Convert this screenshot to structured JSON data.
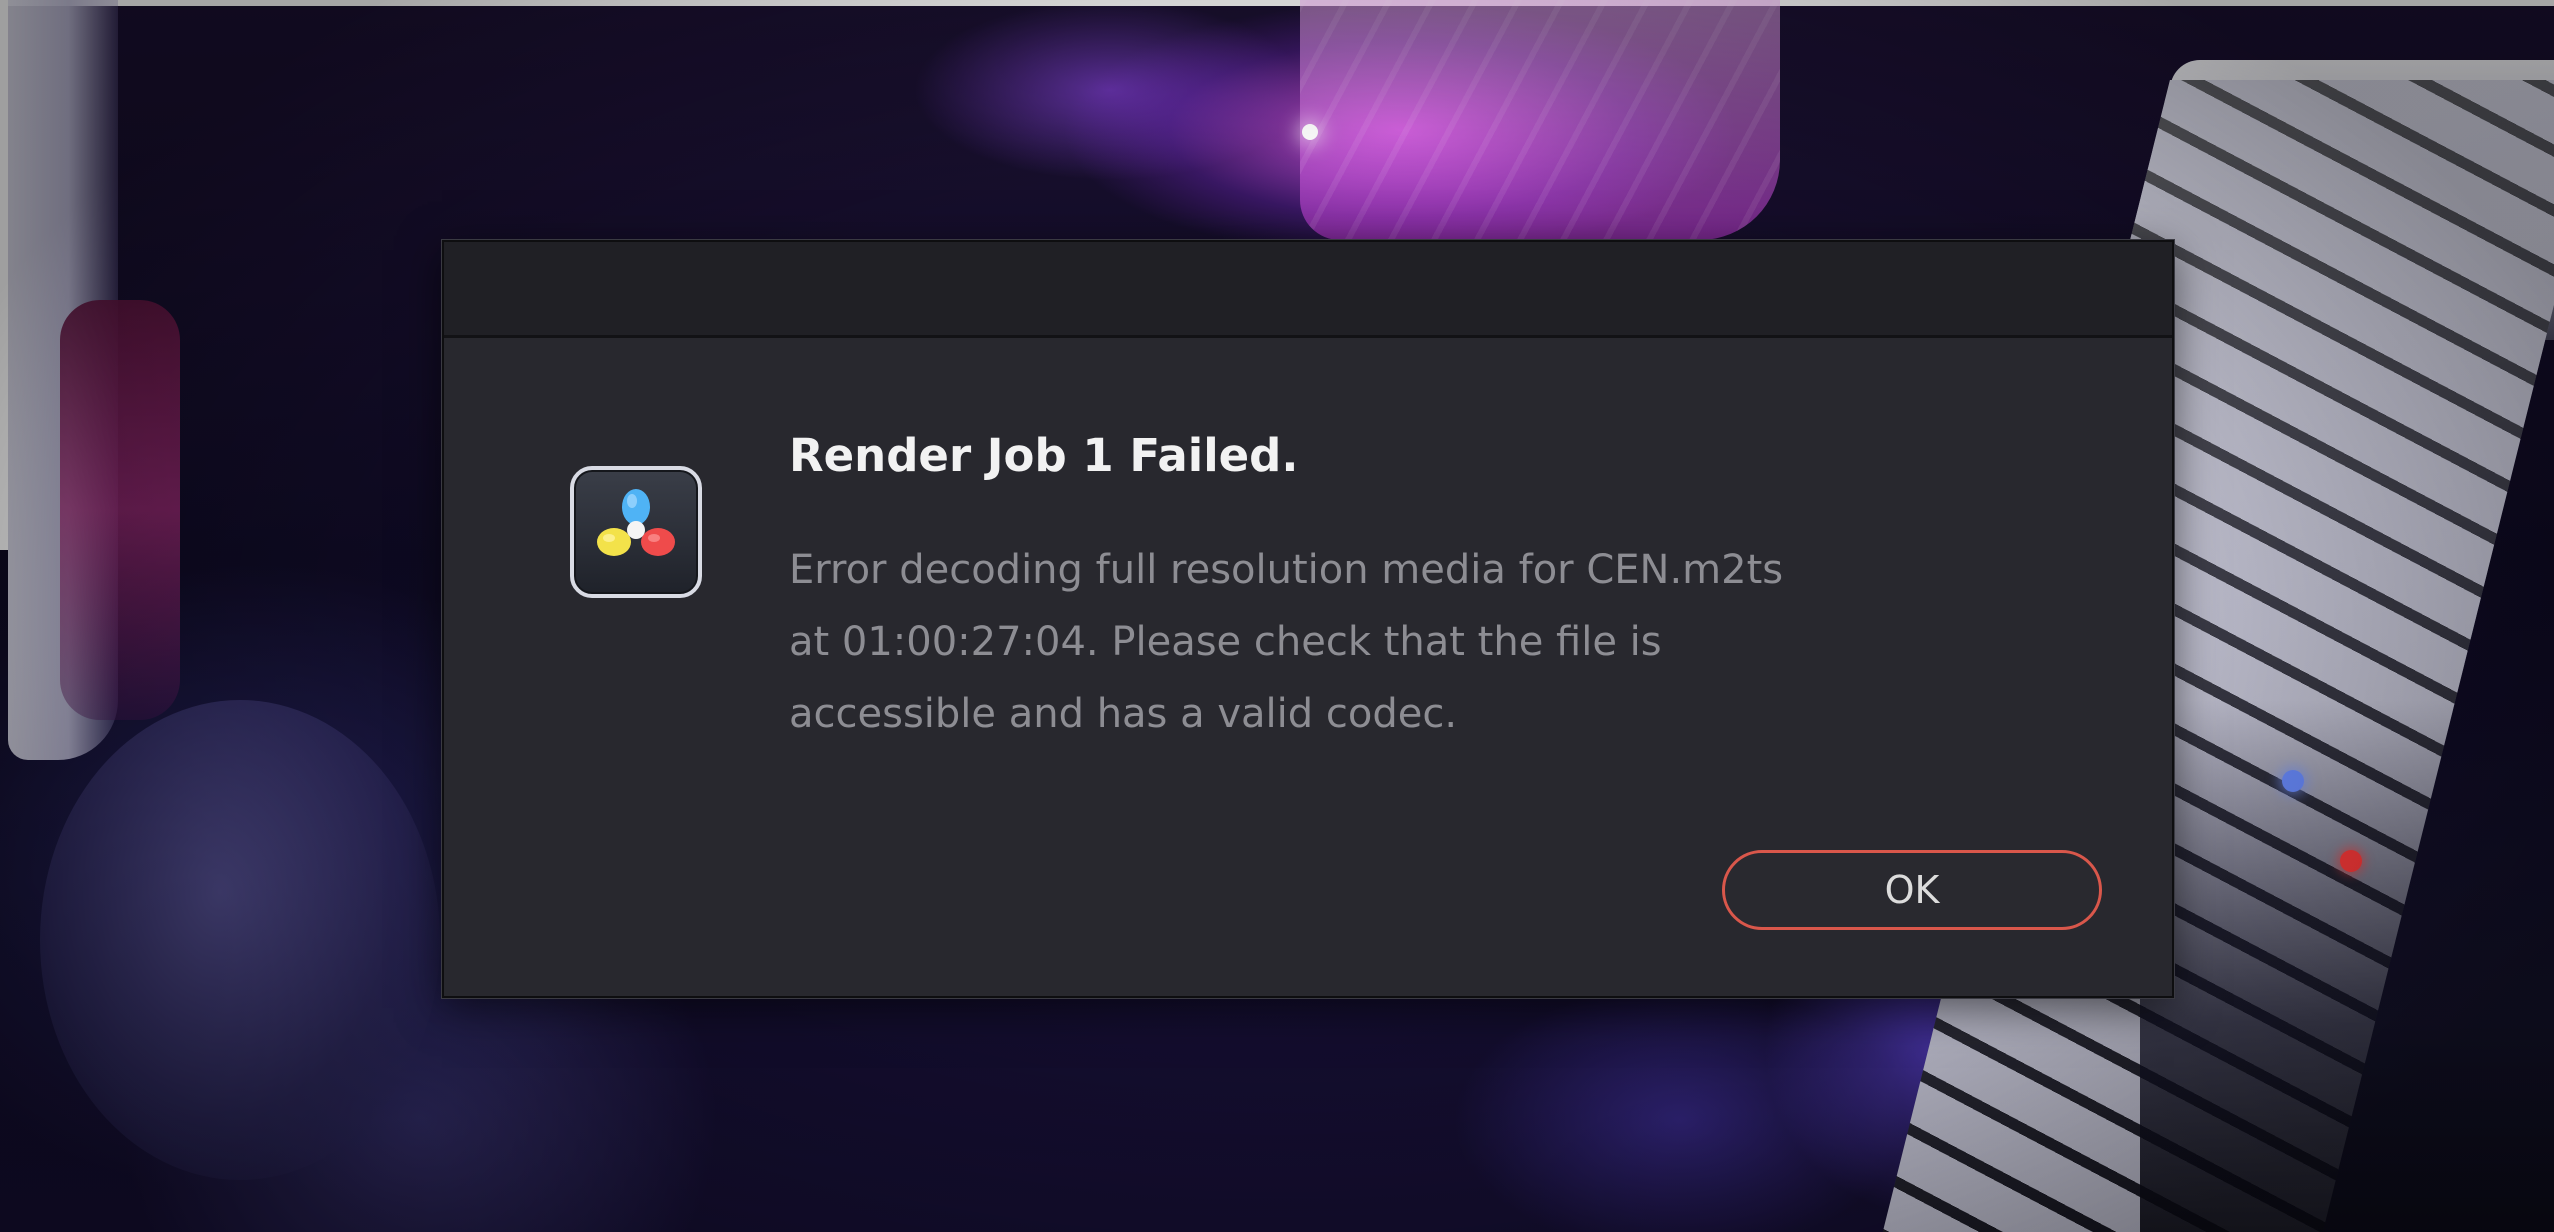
{
  "dialog": {
    "title": "Render Job 1 Failed.",
    "message_lines": [
      "Error decoding full resolution media for CEN.m2ts",
      "at 01:00:27:04. Please check that the file is",
      "accessible and has a valid codec."
    ],
    "ok_label": "OK",
    "icon": "davinci-resolve-app-icon"
  },
  "colors": {
    "dialog_background": "#28282e",
    "titlebar_background": "#202025",
    "title_text": "#f2f2f2",
    "message_text": "#8d8d93",
    "button_border_accent": "#d9574b",
    "icon_petal_blue": "#4fb3f5",
    "icon_petal_yellow": "#f3e24a",
    "icon_petal_red": "#ef4b4b"
  }
}
